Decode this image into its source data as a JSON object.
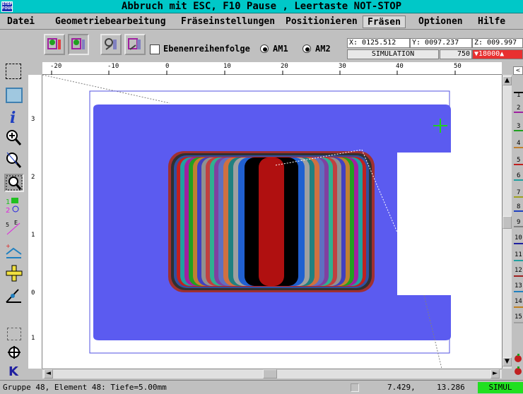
{
  "title_bar": {
    "logo": "STEP FOUR",
    "title": "Abbruch mit ESC,  F10 Pause , Leertaste NOT-STOP"
  },
  "menu": [
    {
      "label": "Datei",
      "active": false
    },
    {
      "label": "Geometriebearbeitung",
      "active": false
    },
    {
      "label": "Fräseinstellungen",
      "active": false
    },
    {
      "label": "Positionieren",
      "active": false
    },
    {
      "label": "Fräsen",
      "active": true
    },
    {
      "label": "Optionen",
      "active": false
    },
    {
      "label": "Hilfe",
      "active": false
    }
  ],
  "toolbar": {
    "ebenen_label": "Ebenenreihenfolge",
    "am1_label": "AM1",
    "am2_label": "AM2",
    "am1_selected": true,
    "am2_selected": true,
    "coords": {
      "x": "X: 0125.512",
      "y": "Y: 0097.237",
      "z": "Z: 009.997"
    },
    "mode": "SIMULATION",
    "speed": "750",
    "rpm": "▼18000▲"
  },
  "ruler": {
    "h_labels": [
      "-20",
      "-10",
      "0",
      "10",
      "20",
      "30",
      "40",
      "50"
    ],
    "v_labels": [
      "3",
      "2",
      "1",
      "0",
      "1"
    ]
  },
  "right_panel": {
    "tool_numbers": [
      "1",
      "2",
      "3",
      "4",
      "5",
      "6",
      "7",
      "8",
      "9",
      "10",
      "11",
      "12",
      "13",
      "14",
      "15"
    ]
  },
  "status": {
    "info": "Gruppe 48, Element 48: Tiefe=5.00mm",
    "x": "7.429,",
    "y": "13.286",
    "mode": "SIMUL"
  },
  "colors": {
    "title_bg": "#00c8c8",
    "workpiece": "#5b5bf0",
    "cursor": "#20d020",
    "status_mode": "#20e020"
  }
}
